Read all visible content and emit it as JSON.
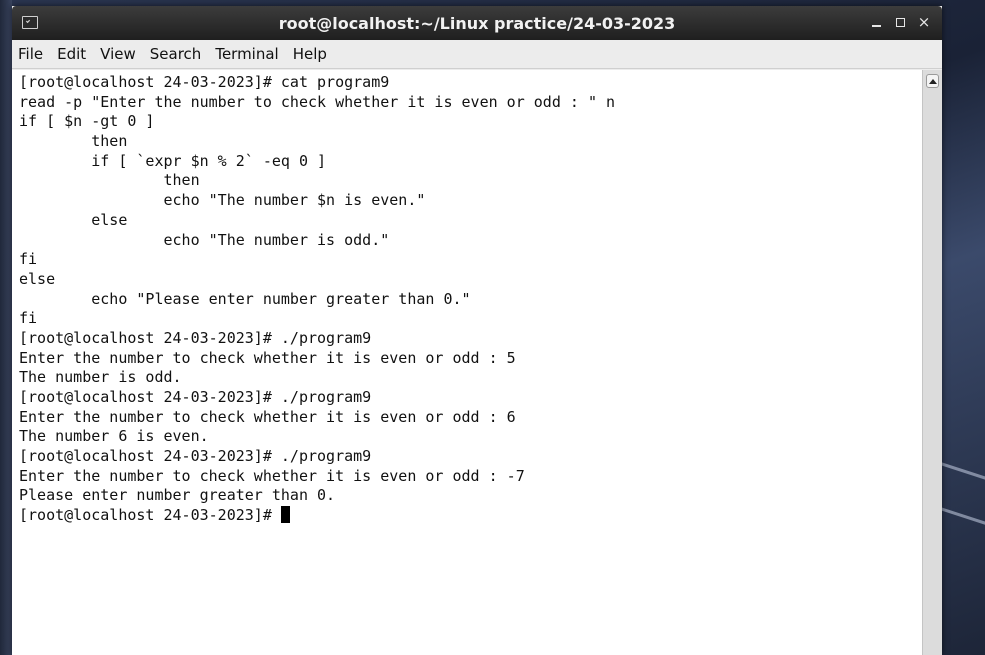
{
  "window": {
    "title": "root@localhost:~/Linux practice/24-03-2023"
  },
  "icons": {
    "app": "terminal-icon",
    "minimize": "minimize-icon",
    "maximize": "maximize-icon",
    "close": "close-icon",
    "scroll_up": "scroll-up-arrow-icon"
  },
  "titlebar": {
    "close_glyph": "×"
  },
  "menubar": {
    "items": [
      {
        "label": "File"
      },
      {
        "label": "Edit"
      },
      {
        "label": "View"
      },
      {
        "label": "Search"
      },
      {
        "label": "Terminal"
      },
      {
        "label": "Help"
      }
    ]
  },
  "terminal": {
    "lines": [
      "[root@localhost 24-03-2023]# cat program9",
      "read -p \"Enter the number to check whether it is even or odd : \" n",
      "if [ $n -gt 0 ]",
      "        then",
      "        if [ `expr $n % 2` -eq 0 ]",
      "                then",
      "                echo \"The number $n is even.\"",
      "        else",
      "                echo \"The number is odd.\"",
      "fi",
      "else",
      "        echo \"Please enter number greater than 0.\"",
      "fi",
      "[root@localhost 24-03-2023]# ./program9",
      "Enter the number to check whether it is even or odd : 5",
      "The number is odd.",
      "[root@localhost 24-03-2023]# ./program9",
      "Enter the number to check whether it is even or odd : 6",
      "The number 6 is even.",
      "[root@localhost 24-03-2023]# ./program9",
      "Enter the number to check whether it is even or odd : -7",
      "Please enter number greater than 0."
    ],
    "prompt": "[root@localhost 24-03-2023]# "
  },
  "colors": {
    "titlebar_bg": "#2a2a2a",
    "terminal_bg": "#ffffff",
    "terminal_fg": "#111111",
    "menubar_bg": "#ececec"
  }
}
